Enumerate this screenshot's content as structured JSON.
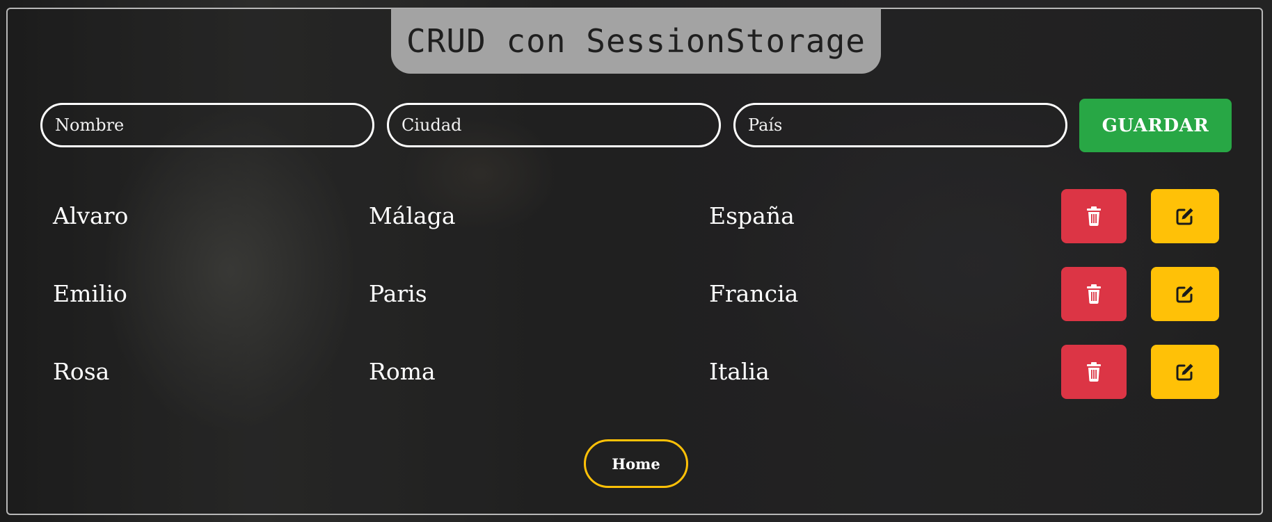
{
  "header": {
    "title": "CRUD con SessionStorage"
  },
  "form": {
    "nombre_placeholder": "Nombre",
    "ciudad_placeholder": "Ciudad",
    "pais_placeholder": "País",
    "save_label": "GUARDAR"
  },
  "rows": [
    {
      "nombre": "Alvaro",
      "ciudad": "Málaga",
      "pais": "España"
    },
    {
      "nombre": "Emilio",
      "ciudad": "Paris",
      "pais": "Francia"
    },
    {
      "nombre": "Rosa",
      "ciudad": "Roma",
      "pais": "Italia"
    }
  ],
  "nav": {
    "home_label": "Home"
  },
  "icons": {
    "delete": "trash-icon",
    "edit": "edit-icon"
  },
  "colors": {
    "save": "#28a745",
    "delete": "#dc3545",
    "edit": "#ffc107",
    "home_border": "#ffc107",
    "title_bg": "#a3a3a3"
  }
}
